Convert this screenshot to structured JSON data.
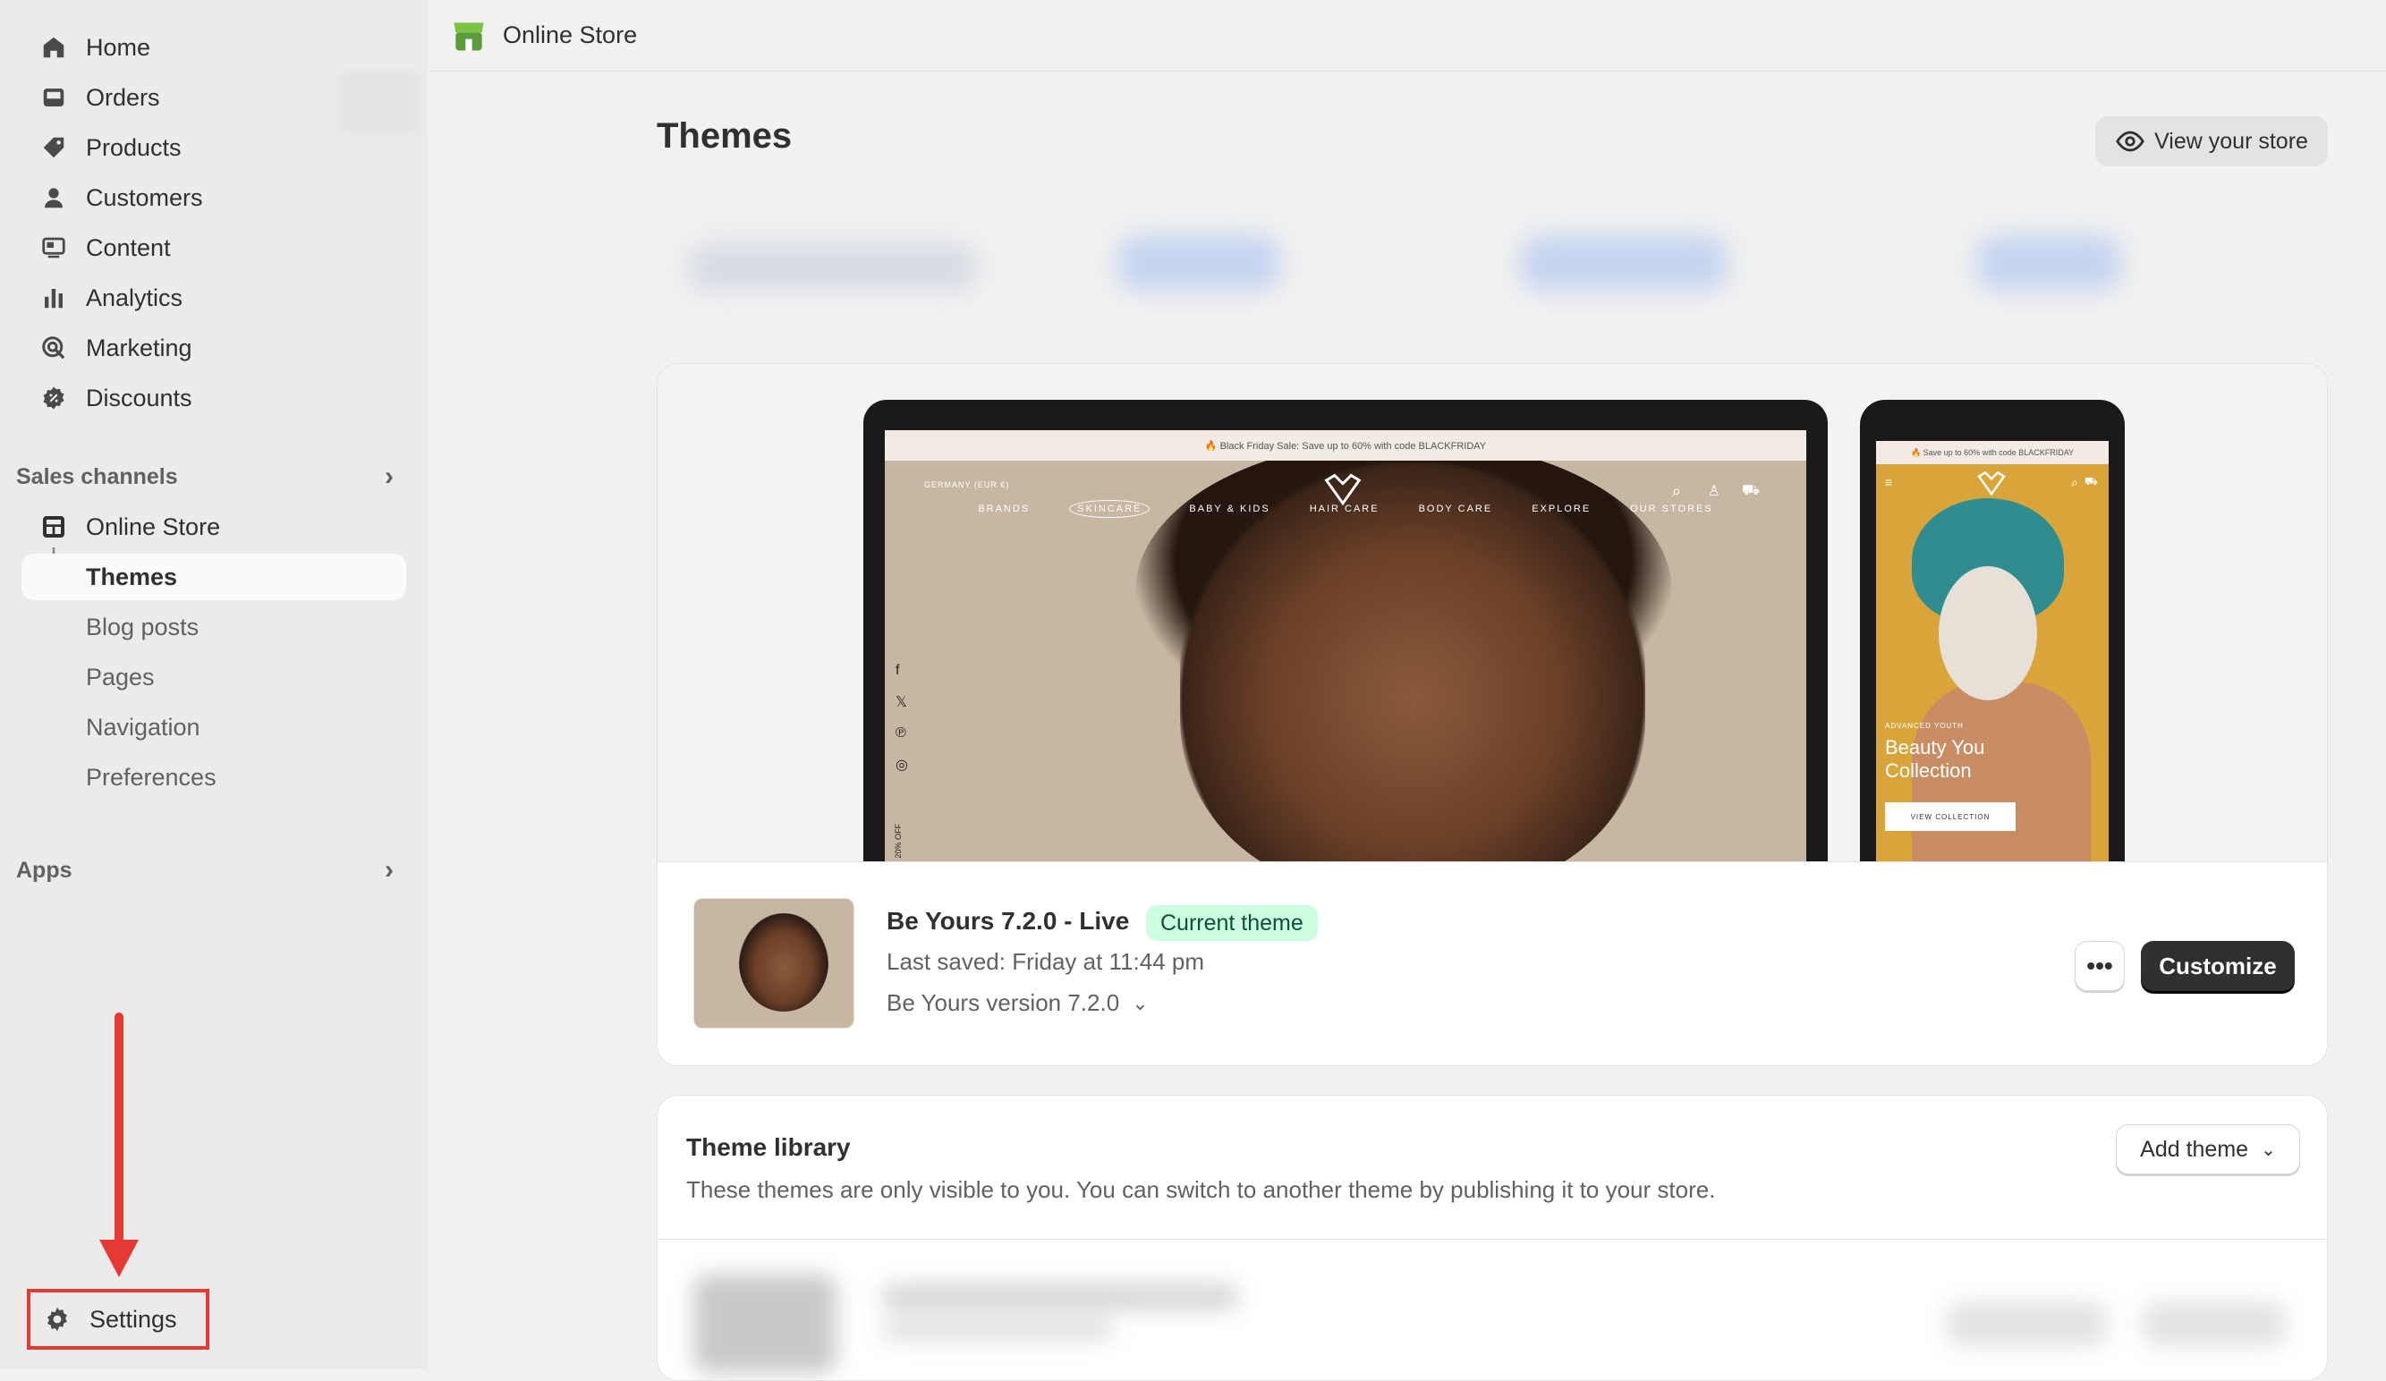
{
  "sidebar": {
    "items": [
      {
        "label": "Home",
        "icon": "home-icon"
      },
      {
        "label": "Orders",
        "icon": "orders-icon"
      },
      {
        "label": "Products",
        "icon": "tag-icon"
      },
      {
        "label": "Customers",
        "icon": "person-icon"
      },
      {
        "label": "Content",
        "icon": "content-icon"
      },
      {
        "label": "Analytics",
        "icon": "bar-chart-icon"
      },
      {
        "label": "Marketing",
        "icon": "target-icon"
      },
      {
        "label": "Discounts",
        "icon": "discount-icon"
      }
    ],
    "sales_channels_label": "Sales channels",
    "online_store_label": "Online Store",
    "sub_items": [
      "Themes",
      "Blog posts",
      "Pages",
      "Navigation",
      "Preferences"
    ],
    "apps_label": "Apps",
    "settings_label": "Settings"
  },
  "topbar": {
    "title": "Online Store"
  },
  "page": {
    "title": "Themes",
    "view_store_label": "View your store"
  },
  "current_theme": {
    "preview_promo_desktop": "🔥 Black Friday Sale: Save up to 60% with code BLACKFRIDAY",
    "preview_promo_mobile": "🔥 Save up to 60% with code BLACKFRIDAY",
    "preview_country": "GERMANY (EUR €)",
    "preview_menu": [
      "BRANDS",
      "SKINCARE",
      "BABY & KIDS",
      "HAIR CARE",
      "BODY CARE",
      "EXPLORE",
      "OUR STORES"
    ],
    "preview_side_text": "20% OFF",
    "preview_mobile_kicker": "ADVANCED YOUTH",
    "preview_mobile_line1": "Beauty You",
    "preview_mobile_line2": "Collection",
    "preview_mobile_button": "VIEW COLLECTION",
    "name": "Be Yours 7.2.0 - Live",
    "badge": "Current theme",
    "last_saved": "Last saved: Friday at 11:44 pm",
    "version": "Be Yours version 7.2.0",
    "more_label": "•••",
    "customize_label": "Customize"
  },
  "library": {
    "title": "Theme library",
    "description": "These themes are only visible to you. You can switch to another theme by publishing it to your store.",
    "add_theme_label": "Add theme"
  },
  "colors": {
    "accent_dark": "#303030",
    "badge_bg": "#cdfee1",
    "badge_text": "#0c5132",
    "annotation_red": "#e53935",
    "brand_green": "#5c9a3b"
  }
}
